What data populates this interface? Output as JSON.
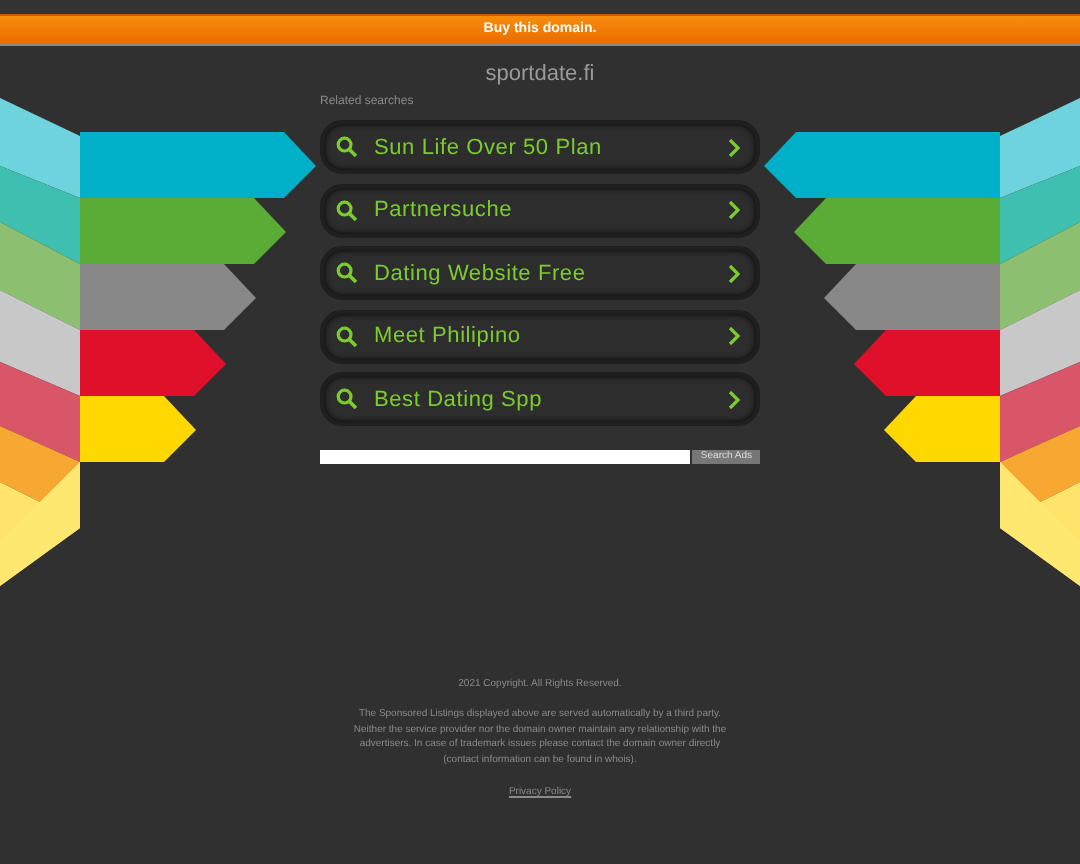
{
  "banner": {
    "label": "Buy this domain."
  },
  "domain": "sportdate.fi",
  "related_label": "Related searches",
  "results": [
    {
      "label": "Sun Life Over 50 Plan"
    },
    {
      "label": "Partnersuche"
    },
    {
      "label": "Dating Website Free"
    },
    {
      "label": "Meet Philipino"
    },
    {
      "label": "Best Dating Spp"
    }
  ],
  "search": {
    "button": "Search Ads"
  },
  "footer": {
    "copyright": "2021 Copyright. All Rights Reserved.",
    "disclaimer": "The Sponsored Listings displayed above are served automatically by a third party. Neither the service provider nor the domain owner maintain any relationship with the advertisers. In case of trademark issues please contact the domain owner directly (contact information can be found in whois).",
    "privacy": "Privacy Policy"
  }
}
